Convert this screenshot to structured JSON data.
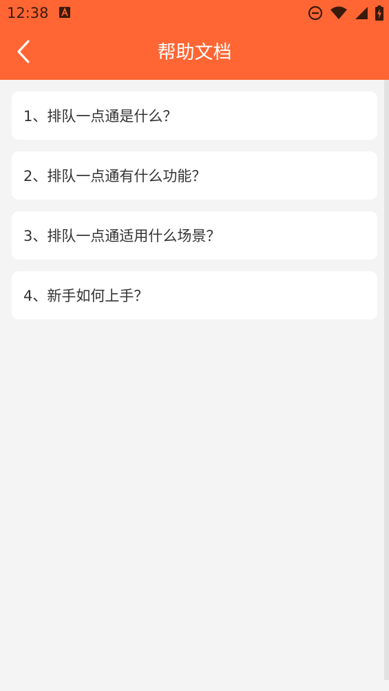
{
  "status_bar": {
    "time": "12:38",
    "icons": [
      "notification-a-icon",
      "do-not-disturb-icon",
      "wifi-icon",
      "cellular-signal-icon",
      "battery-charging-icon"
    ]
  },
  "header": {
    "title": "帮助文档",
    "back_icon": "chevron-left-icon"
  },
  "colors": {
    "accent": "#ff6633",
    "background": "#f4f4f4",
    "card": "#ffffff",
    "text": "#333333"
  },
  "help_items": [
    {
      "label": "1、排队一点通是什么？"
    },
    {
      "label": "2、排队一点通有什么功能？"
    },
    {
      "label": "3、排队一点通适用什么场景？"
    },
    {
      "label": "4、新手如何上手？"
    }
  ]
}
